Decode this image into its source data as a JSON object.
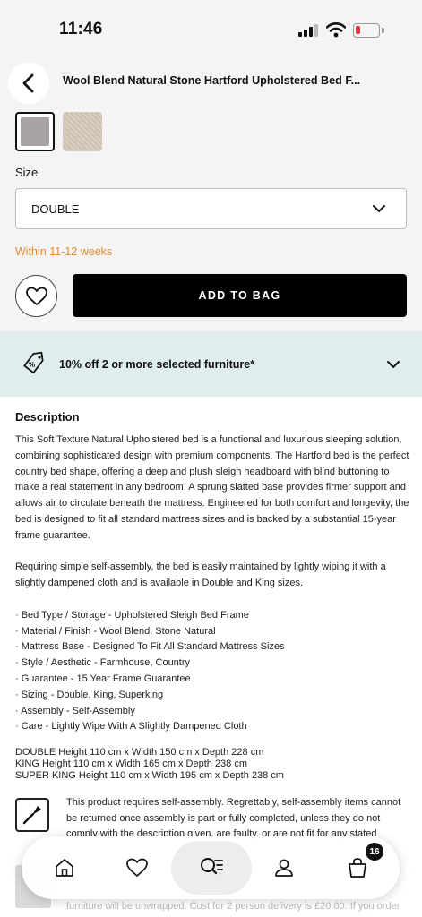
{
  "status_bar": {
    "time": "11:46"
  },
  "header": {
    "title": "Wool Blend Natural Stone Hartford Upholstered Bed F..."
  },
  "options": {
    "size_label": "Size",
    "size_value": "DOUBLE",
    "delivery": "Within 11-12 weeks",
    "add_to_bag": "ADD TO BAG"
  },
  "promo": {
    "text": "10% off 2 or more selected furniture*"
  },
  "description": {
    "title": "Description",
    "paragraph_1": "This Soft Texture Natural Upholstered bed is a functional and luxurious sleeping solution, combining sophisticated design with premium components. The Hartford bed is the perfect country bed shape, offering a deep and plush sleigh headboard with blind buttoning to make a real statement in any bedroom. A sprung slatted base provides firmer support and allows air to circulate beneath the mattress. Engineered for both comfort and longevity, the bed is designed to fit all standard mattress sizes and is backed by a substantial 15-year frame guarantee.",
    "paragraph_2": "Requiring simple self-assembly, the bed is easily maintained by lightly wiping it with a slightly dampened cloth and is available in Double and King sizes.",
    "features": [
      "· Bed Type / Storage - Upholstered Sleigh Bed Frame",
      "· Material / Finish - Wool Blend, Stone Natural",
      "· Mattress Base - Designed To Fit All Standard Mattress Sizes",
      "· Style / Aesthetic - Farmhouse, Country",
      "· Guarantee - 15 Year Frame Guarantee",
      "· Sizing - Double, King, Superking",
      "· Assembly - Self-Assembly",
      "· Care - Lightly Wipe With A Slightly Dampened Cloth"
    ],
    "dimensions": [
      "DOUBLE Height 110 cm x Width 150 cm x Depth 228 cm",
      "KING Height 110 cm x Width 165 cm x Depth 238 cm",
      "SUPER KING Height 110 cm x Width 195 cm x Depth 238 cm"
    ]
  },
  "notices": {
    "assembly": "This product requires self-assembly. Regrettably, self-assembly items cannot be returned once assembly is part or fully completed, unless they do not comply with the description given, are faulty, or are not fit for any stated",
    "delivery_partial": "furniture will be unwrapped. Cost for 2 person delivery is £20.00. If you order"
  },
  "bottom_nav": {
    "bag_count": "16"
  },
  "colors": {
    "accent_orange": "#e58a2c",
    "promo_bg": "#dfeeed",
    "primary": "#000000"
  }
}
